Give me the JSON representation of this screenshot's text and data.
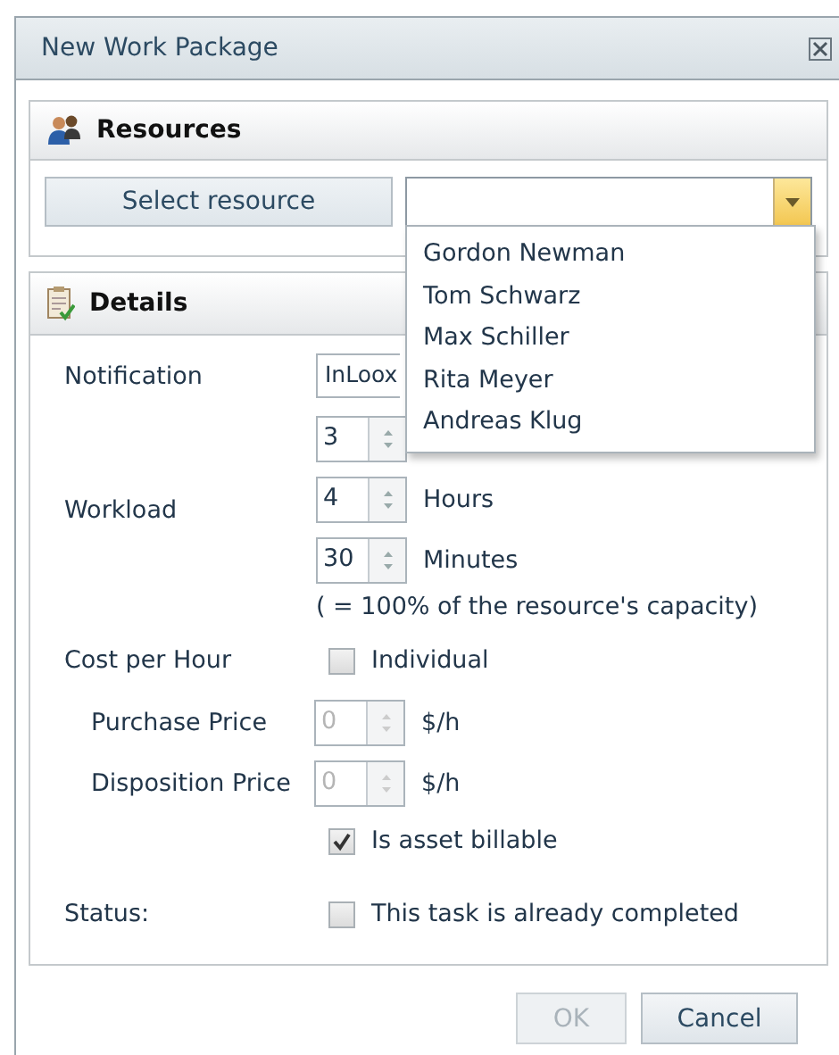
{
  "window": {
    "title": "New Work Package"
  },
  "resources": {
    "title": "Resources",
    "select_button": "Select resource",
    "dropdown": {
      "expanded": true,
      "options": [
        {
          "label": "Gordon Newman",
          "selected": false
        },
        {
          "label": "Tom Schwarz",
          "selected": false
        },
        {
          "label": "Max Schiller",
          "selected": false
        },
        {
          "label": "Rita Meyer",
          "selected": false
        },
        {
          "label": "Andreas Klug",
          "selected": false
        }
      ]
    }
  },
  "details": {
    "title": "Details",
    "notification": {
      "label": "Notification",
      "value": "InLoox"
    },
    "workload": {
      "label": "Workload",
      "spinners": [
        {
          "value": "3",
          "disabled": false
        },
        {
          "value": "4",
          "unit": "Hours",
          "disabled": false
        },
        {
          "value": "30",
          "unit": "Minutes",
          "disabled": false
        }
      ],
      "note": "( = 100% of the resource's capacity)"
    },
    "cost": {
      "label": "Cost per Hour",
      "individual": {
        "label": "Individual",
        "checked": false
      },
      "prices": [
        {
          "label": "Purchase Price",
          "value": "0",
          "unit": "$/h",
          "disabled": true
        },
        {
          "label": "Disposition Price",
          "value": "0",
          "unit": "$/h",
          "disabled": true
        }
      ],
      "billable": {
        "label": "Is asset billable",
        "checked": true
      }
    },
    "status": {
      "label": "Status:",
      "completed": {
        "label": "This task is already completed",
        "checked": false
      }
    }
  },
  "buttons": [
    {
      "label": "OK",
      "disabled": true
    },
    {
      "label": "Cancel",
      "disabled": false
    }
  ]
}
